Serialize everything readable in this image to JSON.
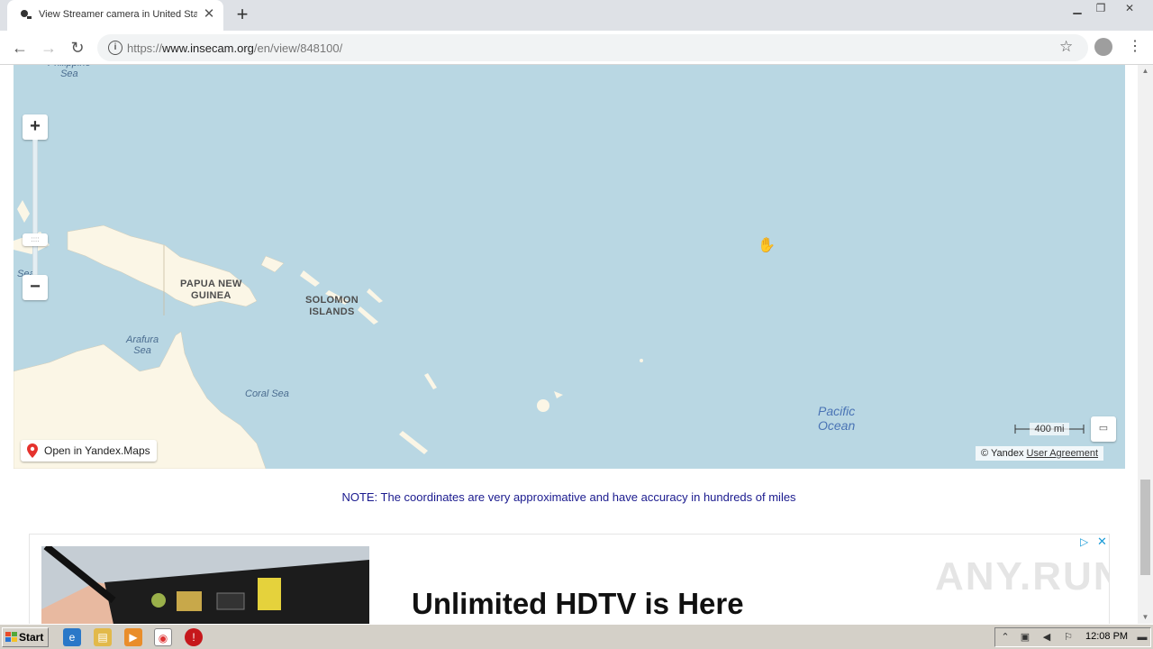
{
  "browser": {
    "tab_title": "View Streamer camera in United States",
    "tab_close": "✕",
    "new_tab": "+",
    "url_scheme": "https://",
    "url_host": "www.insecam.org",
    "url_path": "/en/view/848100/"
  },
  "map": {
    "labels": {
      "philippine_sea": "Philippine\nSea",
      "papua": "PAPUA NEW\nGUINEA",
      "solomon": "SOLOMON\nISLANDS",
      "arafura": "Arafura\nSea",
      "coral": "Coral Sea",
      "pacific": "Pacific\nOcean",
      "sea_partial": "Sea"
    },
    "zoom_in": "+",
    "zoom_out": "−",
    "zoom_handle": "::::",
    "open_button": "Open in Yandex.Maps",
    "scale": "400 mi",
    "copyright_prefix": "© Yandex",
    "user_agreement": "User Agreement",
    "colors": {
      "water": "#b9d7e3",
      "land": "#fbf6e6"
    }
  },
  "note": "NOTE: The coordinates are very approximative and have accuracy in hundreds of miles",
  "ad": {
    "headline": "Unlimited HDTV is Here",
    "watermark": "ANY.RUN"
  },
  "taskbar": {
    "start": "Start",
    "clock": "12:08 PM"
  }
}
